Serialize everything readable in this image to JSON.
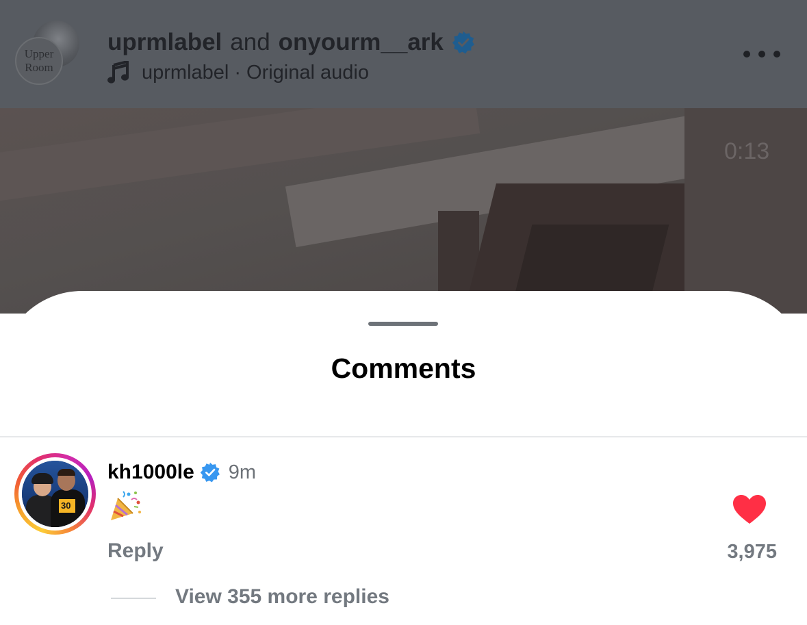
{
  "header": {
    "avatar_text_line1": "Upper",
    "avatar_text_line2": "Room",
    "user1": "uprmlabel",
    "joiner": "and",
    "user2": "onyourm__ark",
    "audio_user": "uprmlabel",
    "audio_sep": "·",
    "audio_label": "Original audio",
    "more_icon": "more-horizontal-icon"
  },
  "video": {
    "timestamp": "0:13"
  },
  "sheet": {
    "title": "Comments"
  },
  "comment": {
    "username": "kh1000le",
    "time": "9m",
    "emoji_icon": "party-popper-icon",
    "reply_label": "Reply",
    "like_count": "3,975",
    "like_color": "#ff2f45",
    "view_replies": "View 355 more replies",
    "jersey_text": "30"
  },
  "colors": {
    "verified": "#3897f0",
    "overlay_dim": "#575b61"
  }
}
